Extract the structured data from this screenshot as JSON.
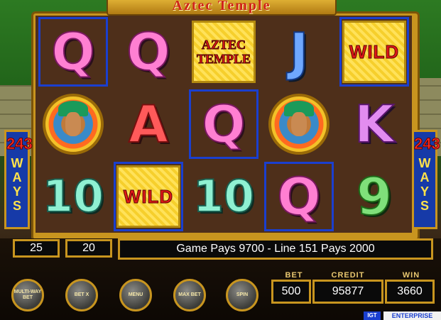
{
  "game": {
    "title": "Aztec Temple",
    "ways_number": "243",
    "ways_word": "WAYS"
  },
  "reels": [
    [
      {
        "type": "letter",
        "text": "Q",
        "cls": "Q",
        "hl": true
      },
      {
        "type": "portrait",
        "name": "aztec-warrior"
      },
      {
        "type": "number",
        "text": "10",
        "cls": "T",
        "hl": false
      }
    ],
    [
      {
        "type": "letter",
        "text": "Q",
        "cls": "Q",
        "hl": false
      },
      {
        "type": "letter",
        "text": "A",
        "cls": "A",
        "hl": false
      },
      {
        "type": "wild",
        "text": "WILD",
        "hl": true
      }
    ],
    [
      {
        "type": "logo",
        "text": "AZTEC TEMPLE",
        "hl": false
      },
      {
        "type": "letter",
        "text": "Q",
        "cls": "Q",
        "hl": true
      },
      {
        "type": "number",
        "text": "10",
        "cls": "T",
        "hl": false
      }
    ],
    [
      {
        "type": "letter",
        "text": "J",
        "cls": "J",
        "hl": false
      },
      {
        "type": "portrait",
        "name": "aztec-princess"
      },
      {
        "type": "letter",
        "text": "Q",
        "cls": "Q",
        "hl": true
      }
    ],
    [
      {
        "type": "wild",
        "text": "WILD",
        "hl": true
      },
      {
        "type": "letter",
        "text": "K",
        "cls": "K",
        "hl": false
      },
      {
        "type": "number",
        "text": "9",
        "cls": "N",
        "hl": false
      }
    ]
  ],
  "info": {
    "lines_value": "25",
    "bet_per_line_value": "20",
    "message": "Game Pays 9700 - Line 151 Pays 2000"
  },
  "meters": {
    "bet_label": "BET",
    "bet_value": "500",
    "credit_label": "CREDIT",
    "credit_value": "95877",
    "win_label": "WIN",
    "win_value": "3660"
  },
  "buttons": [
    {
      "label": "MULTI-WAY BET"
    },
    {
      "label": "BET X"
    },
    {
      "label": "MENU"
    },
    {
      "label": "MAX BET"
    },
    {
      "label": "SPIN"
    }
  ],
  "footer": {
    "badge": "IGT",
    "brand": "ENTERPRISE"
  },
  "colors": {
    "highlight": "#1a3fcf",
    "frame_gold": "#c8951f",
    "reel_bg": "#4e2f1a"
  }
}
